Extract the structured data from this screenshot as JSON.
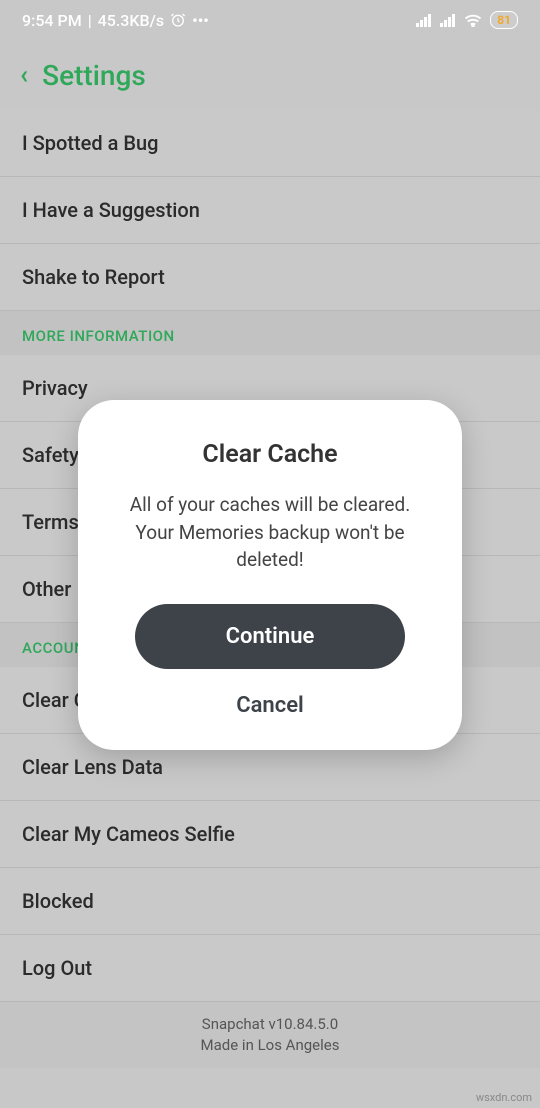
{
  "status": {
    "time": "9:54 PM",
    "speed": "45.3KB/s",
    "battery": "81"
  },
  "header": {
    "title": "Settings"
  },
  "sections": {
    "top_items": [
      "I Spotted a Bug",
      "I Have a Suggestion",
      "Shake to Report"
    ],
    "more_info_header": "MORE INFORMATION",
    "more_info_items": [
      "Privacy",
      "Safety",
      "Terms",
      "Other"
    ],
    "account_header": "ACCOUNT ACTIONS",
    "account_items": [
      "Clear Cache",
      "Clear Lens Data",
      "Clear My Cameos Selfie",
      "Blocked",
      "Log Out"
    ]
  },
  "footer": {
    "version": "Snapchat v10.84.5.0",
    "location": "Made in Los Angeles"
  },
  "dialog": {
    "title": "Clear Cache",
    "body": "All of your caches will be cleared. Your Memories backup won't be deleted!",
    "continue": "Continue",
    "cancel": "Cancel"
  },
  "watermark": "wsxdn.com"
}
